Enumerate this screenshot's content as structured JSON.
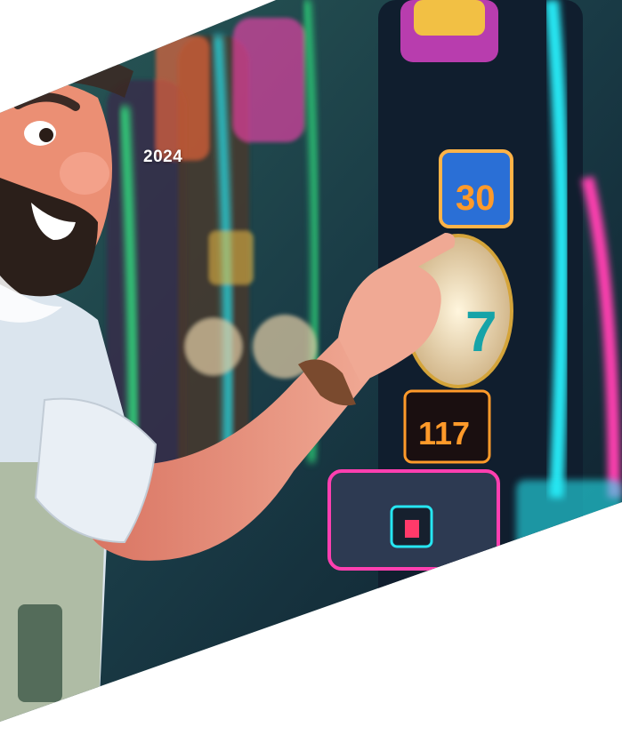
{
  "hero": {
    "year": "2024"
  },
  "colors": {
    "page_background": "#ffffff",
    "neon_pink": "#ff3fb0",
    "neon_cyan": "#26e6f2",
    "neon_green": "#33ff88",
    "machine_dark": "#162a3c",
    "skin": "#e9957e",
    "shirt": "#dbe5ee",
    "beard": "#2b1f1a"
  },
  "illustration": {
    "subject": "cartoon-man-playing-slot-machine",
    "icons": [
      "slot-machine-icon",
      "reel-seven-icon",
      "credit-display-icon"
    ]
  }
}
